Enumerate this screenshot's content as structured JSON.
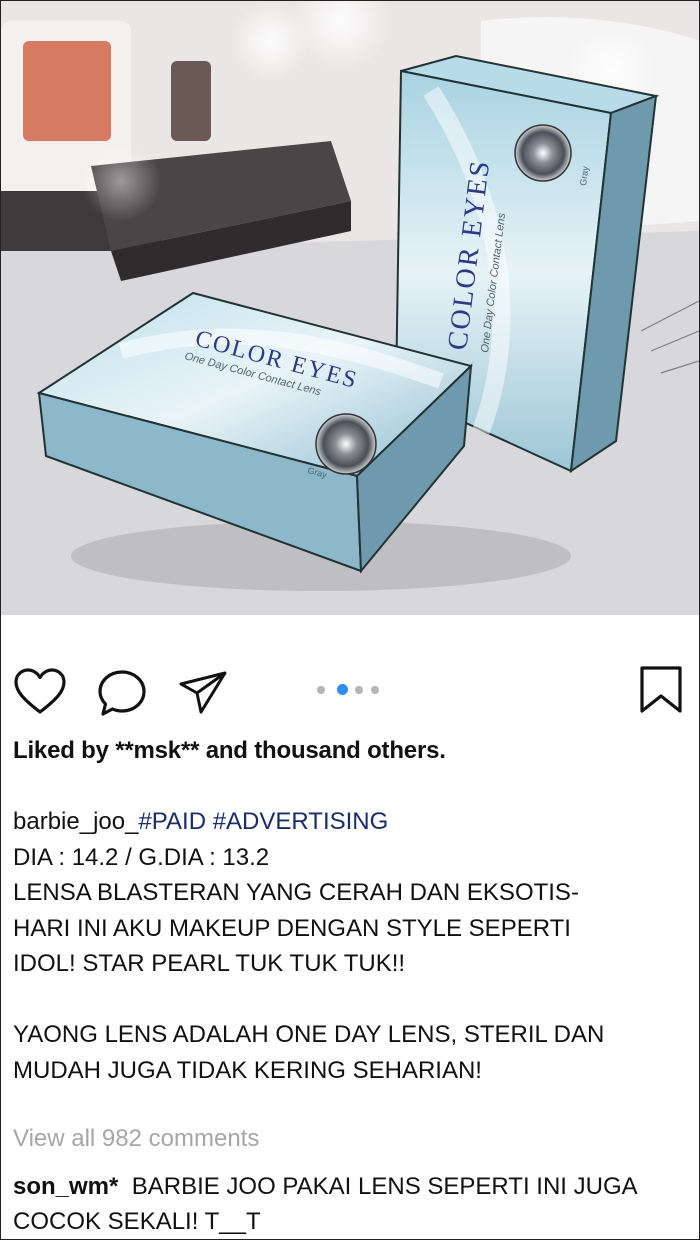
{
  "post_image": {
    "box_brand": "COLOR EYES",
    "box_subtitle": "One Day Color Contact Lens",
    "box_color_label": "Gray"
  },
  "carousel": {
    "count": 4,
    "active_index": 1
  },
  "likes": {
    "prefix": "Liked by ",
    "user": "**msk**",
    "suffix": " and thousand others."
  },
  "caption": {
    "username": "barbie_joo_",
    "hashtags": "#PAID #ADVERTISING",
    "line_specs": "DIA : 14.2 / G.DIA : 13.2",
    "paragraph1": "LENSA BLASTERAN YANG CERAH DAN EKSOTIS-\nHARI INI AKU MAKEUP DENGAN STYLE SEPERTI\nIDOL! STAR PEARL TUK TUK TUK!!",
    "paragraph2": "YAONG LENS ADALAH ONE DAY LENS, STERIL DAN\nMUDAH JUGA TIDAK KERING SEHARIAN!"
  },
  "comments": {
    "view_all_label": "View all 982 comments",
    "items": [
      {
        "username": "son_wm*",
        "text": "BARBIE JOO PAKAI LENS SEPERTI INI JUGA COCOK SEKALI! T__T"
      }
    ]
  },
  "colors": {
    "accent_dot": "#2f8ff0",
    "hashtag": "#1a2d6b",
    "muted_text": "#a6a6a6",
    "box_blue": "#86b6c9"
  }
}
